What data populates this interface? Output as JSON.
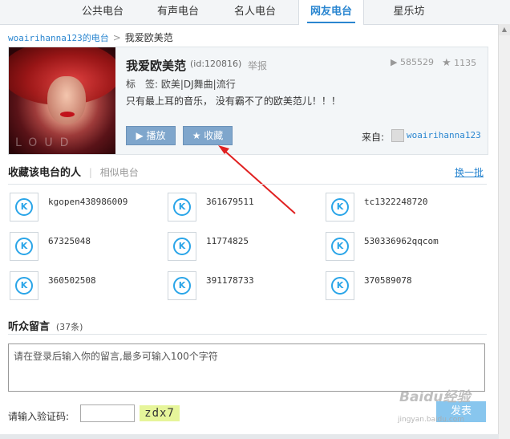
{
  "nav": {
    "tabs": [
      {
        "label": "公共电台"
      },
      {
        "label": "有声电台"
      },
      {
        "label": "名人电台"
      },
      {
        "label": "网友电台",
        "active": true
      },
      {
        "label": "星乐坊"
      }
    ]
  },
  "breadcrumb": {
    "parent": "woairihanna123的电台",
    "separator": ">",
    "current": "我爱欧美范"
  },
  "station": {
    "name": "我爱欧美范",
    "id_text": "(id:120816)",
    "report": "举报",
    "plays": "585529",
    "favorites": "1135",
    "tags": "标　签: 欧美|DJ舞曲|流行",
    "description": "只有最上耳的音乐，  没有霸不了的欧美范儿！！！",
    "play_label": "播放",
    "collect_label": "收藏",
    "source_label": "来自:",
    "source_user": "woairihanna123",
    "cover_text": "LOUD"
  },
  "collectors": {
    "title": "收藏该电台的人",
    "tab_similar": "相似电台",
    "refresh": "换一批",
    "users": [
      {
        "name": "kgopen438986009"
      },
      {
        "name": "361679511"
      },
      {
        "name": "tc1322248720"
      },
      {
        "name": "67325048"
      },
      {
        "name": "11774825"
      },
      {
        "name": "530336962qqcom"
      },
      {
        "name": "360502508"
      },
      {
        "name": "391178733"
      },
      {
        "name": "370589078"
      }
    ]
  },
  "comments": {
    "title": "听众留言",
    "count": "(37条)",
    "placeholder": "请在登录后输入你的留言,最多可输入100个字符",
    "verify_label": "请输入验证码:",
    "captcha": "zdx7",
    "send": "发表"
  },
  "watermark": {
    "brand": "Baidu经验",
    "url": "jingyan.baidu.com"
  },
  "colors": {
    "accent": "#2a86d0",
    "button": "#7fa6cc",
    "annotation_arrow": "#e02020"
  }
}
